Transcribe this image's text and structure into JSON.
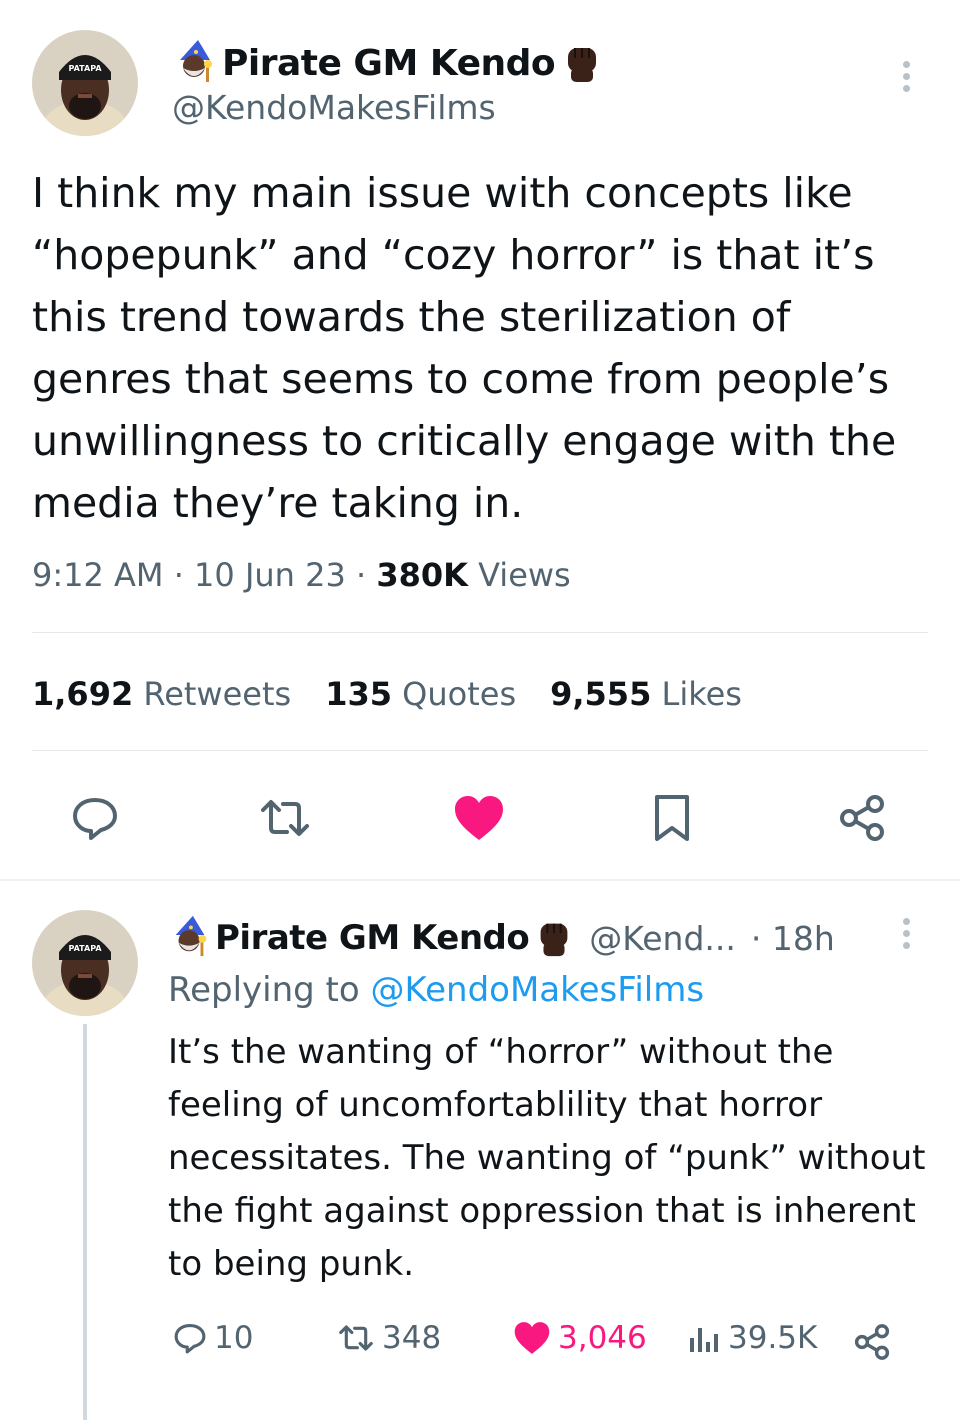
{
  "tweet": {
    "display_name": "Pirate GM Kendo",
    "handle": "@KendoMakesFilms",
    "text": "I think my main issue with concepts like “hopepunk” and “cozy horror” is that it’s this trend towards the sterilization of genres that seems to come from people’s unwillingness to critically engage with the media they’re taking in.",
    "time": "9:12 AM",
    "date": "10 Jun 23",
    "views_count": "380K",
    "views_label": "Views",
    "separator": "·",
    "retweets_count": "1,692",
    "retweets_label": "Retweets",
    "quotes_count": "135",
    "quotes_label": "Quotes",
    "likes_count": "9,555",
    "likes_label": "Likes",
    "avatar_hat_text": "PATAPA",
    "name_emojis": [
      "mage-icon",
      "raised-fist-icon"
    ],
    "actions": [
      "reply-icon",
      "retweet-icon",
      "like-icon",
      "bookmark-icon",
      "share-icon"
    ],
    "liked": true
  },
  "reply": {
    "display_name": "Pirate GM Kendo",
    "handle": "@Kend...",
    "time": "· 18h",
    "replying_prefix": "Replying to",
    "replying_handle": "@KendoMakesFilms",
    "text": "It’s the wanting of “horror” without the feeling of uncomfortablility that horror necessitates. The wanting of “punk” without the fight against oppression that is inherent to being punk.",
    "replies": "10",
    "retweets": "348",
    "likes": "3,046",
    "views": "39.5K",
    "liked": true
  },
  "colors": {
    "like": "#f91880",
    "link": "#1d9bf0",
    "secondary_text": "#536471",
    "primary_text": "#0f1419"
  }
}
